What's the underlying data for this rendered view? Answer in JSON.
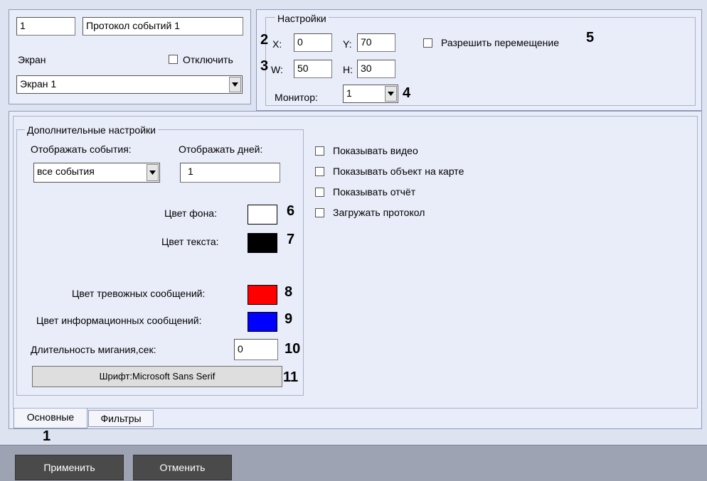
{
  "object": {
    "id": "1",
    "name": "Протокол событий 1",
    "screen_label": "Экран",
    "disable_label": "Отключить",
    "screen_value": "Экран 1"
  },
  "settings": {
    "title": "Настройки",
    "x_label": "X:",
    "x_value": "0",
    "y_label": "Y:",
    "y_value": "70",
    "w_label": "W:",
    "w_value": "50",
    "h_label": "H:",
    "h_value": "30",
    "monitor_label": "Монитор:",
    "monitor_value": "1",
    "allow_move_label": "Разрешить перемещение"
  },
  "additional": {
    "title": "Дополнительные настройки",
    "show_events_label": "Отображать события:",
    "show_events_value": "все события",
    "show_days_label": "Отображать дней:",
    "show_days_value": "1",
    "bg_color_label": "Цвет фона:",
    "text_color_label": "Цвет текста:",
    "alarm_color_label": "Цвет тревожных сообщений:",
    "info_color_label": "Цвет информационных сообщений:",
    "blink_label": "Длительность мигания,сек:",
    "blink_value": "0",
    "font_button": "Шрифт:Microsoft Sans Serif"
  },
  "colors": {
    "background": "#ffffff",
    "text": "#000000",
    "alarm": "#ff0000",
    "info": "#0000ff"
  },
  "options": {
    "show_video": "Показывать видео",
    "show_on_map": "Показывать объект на карте",
    "show_report": "Показывать отчёт",
    "load_protocol": "Загружать протокол"
  },
  "tabs": {
    "main": "Основные",
    "filters": "Фильтры"
  },
  "buttons": {
    "apply": "Применить",
    "cancel": "Отменить"
  },
  "callouts": {
    "n1": "1",
    "n2": "2",
    "n3": "3",
    "n4": "4",
    "n5": "5",
    "n6": "6",
    "n7": "7",
    "n8": "8",
    "n9": "9",
    "n10": "10",
    "n11": "11"
  }
}
